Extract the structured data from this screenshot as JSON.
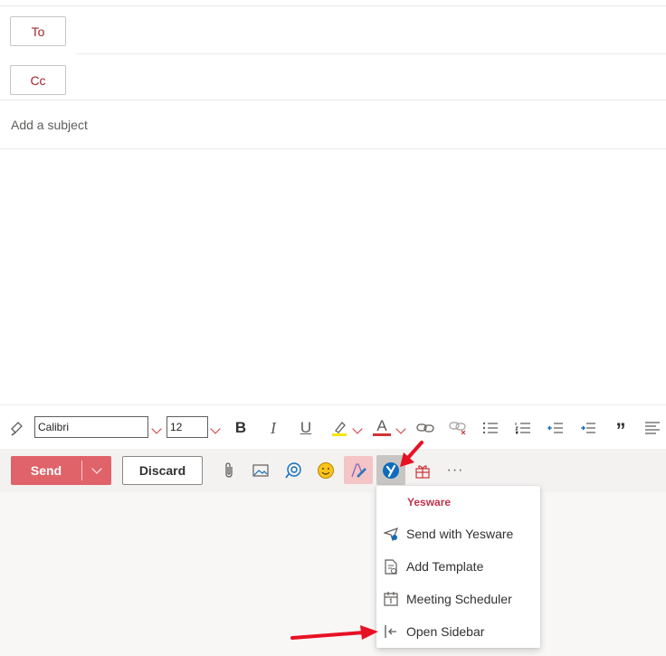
{
  "recipients": {
    "to_label": "To",
    "cc_label": "Cc"
  },
  "subject": {
    "placeholder": "Add a subject"
  },
  "format_toolbar": {
    "font_name": "Calibri",
    "font_size": "12",
    "icons": [
      "format-painter-icon",
      "bold-icon",
      "italic-icon",
      "underline-icon",
      "highlight-icon",
      "font-color-icon",
      "link-icon",
      "unlink-icon",
      "bullets-icon",
      "numbering-icon",
      "decrease-indent-icon",
      "increase-indent-icon",
      "quote-icon",
      "align-icon"
    ],
    "bold_glyph": "B",
    "italic_glyph": "I",
    "underline_glyph": "U",
    "font_color_glyph": "A",
    "quote_glyph": "”"
  },
  "action_bar": {
    "send_label": "Send",
    "discard_label": "Discard",
    "more_label": "···",
    "icons": [
      "attach-icon",
      "image-icon",
      "loop-icon",
      "emoji-icon",
      "editor-icon",
      "yesware-icon",
      "apps-icon",
      "more-icon"
    ]
  },
  "yesware_menu": {
    "header": "Yesware",
    "items": [
      {
        "label": "Send with Yesware",
        "icon": "send-yesware-icon"
      },
      {
        "label": "Add Template",
        "icon": "template-icon"
      },
      {
        "label": "Meeting Scheduler",
        "icon": "calendar-icon"
      },
      {
        "label": "Open Sidebar",
        "icon": "sidebar-icon"
      }
    ]
  },
  "colors": {
    "accent": "#a4262c",
    "send_button": "#e0636a",
    "yesware_header": "#c4314b",
    "annotation_arrow": "#e81123",
    "yesware_blue": "#0f6cbd"
  }
}
